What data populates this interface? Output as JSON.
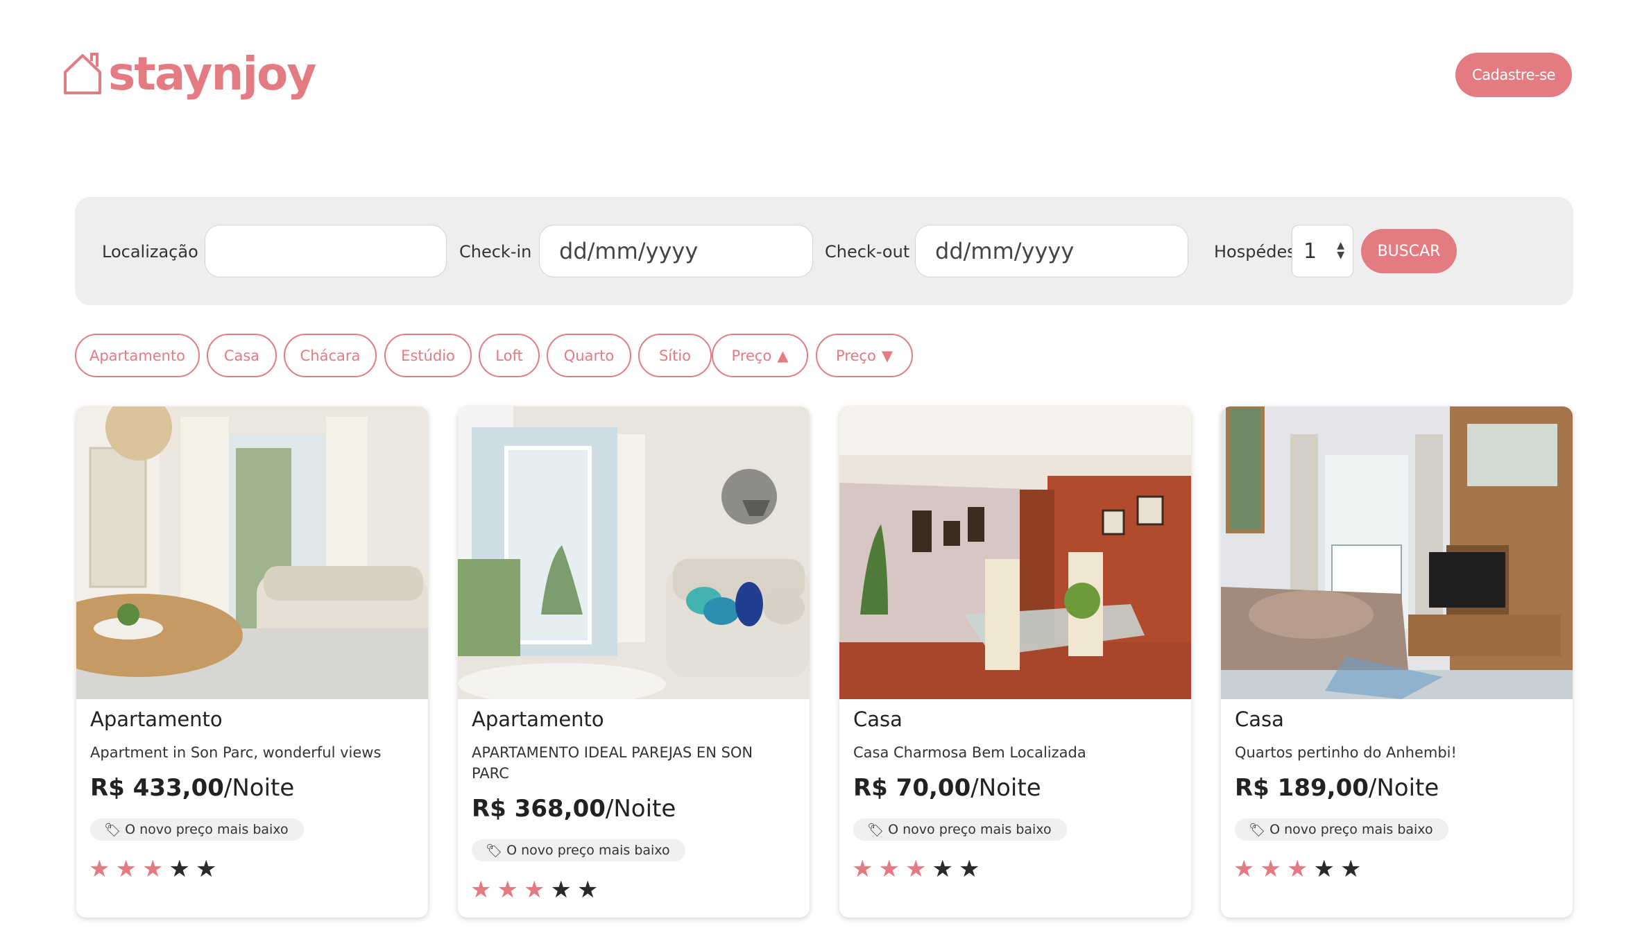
{
  "header": {
    "logo_text": "staynjoy",
    "signup_label": "Cadastre-se"
  },
  "search": {
    "location_label": "Localização",
    "location_value": "",
    "checkin_label": "Check-in",
    "checkin_placeholder": "dd/mm/yyyy",
    "checkout_label": "Check-out",
    "checkout_placeholder": "dd/mm/yyyy",
    "guests_label": "Hospédes",
    "guests_value": "1",
    "search_label": "BUSCAR"
  },
  "filters": [
    {
      "label": "Apartamento"
    },
    {
      "label": "Casa"
    },
    {
      "label": "Chácara"
    },
    {
      "label": "Estúdio"
    },
    {
      "label": "Loft"
    },
    {
      "label": "Quarto"
    },
    {
      "label": "Sítio"
    },
    {
      "label": "Preço",
      "arrow": "▲"
    },
    {
      "label": "Preço",
      "arrow": "▼"
    }
  ],
  "listings": [
    {
      "type": "Apartamento",
      "description": "Apartment in Son Parc, wonderful views",
      "price": "R$ 433,00",
      "unit": "/Noite",
      "badge": "O novo preço mais baixo",
      "rating": 3,
      "max_rating": 5
    },
    {
      "type": "Apartamento",
      "description": "APARTAMENTO IDEAL PAREJAS EN SON PARC",
      "price": "R$ 368,00",
      "unit": "/Noite",
      "badge": "O novo preço mais baixo",
      "rating": 3,
      "max_rating": 5
    },
    {
      "type": "Casa",
      "description": "Casa Charmosa Bem Localizada",
      "price": "R$ 70,00",
      "unit": "/Noite",
      "badge": "O novo preço mais baixo",
      "rating": 3,
      "max_rating": 5
    },
    {
      "type": "Casa",
      "description": "Quartos pertinho do Anhembi!",
      "price": "R$ 189,00",
      "unit": "/Noite",
      "badge": "O novo preço mais baixo",
      "rating": 3,
      "max_rating": 5
    }
  ],
  "colors": {
    "accent": "#e57b82",
    "search_bg": "#eeeeee",
    "star_off": "#2a2a2a"
  },
  "icons": {
    "logo": "house-outline-icon",
    "badge": "tag-icon",
    "rating": "star-icon",
    "sort_up": "triangle-up-icon",
    "sort_down": "triangle-down-icon"
  }
}
